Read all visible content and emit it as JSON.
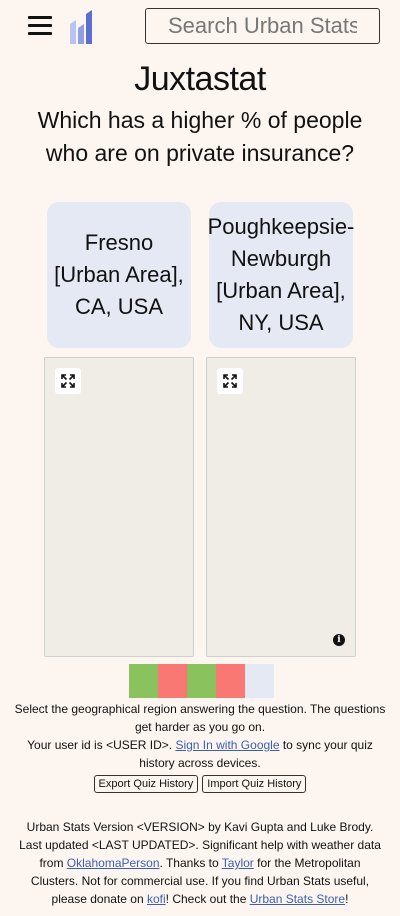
{
  "header": {
    "search_placeholder": "Search Urban Stats",
    "logo_colors": [
      "#5a6fd1",
      "#8f9fe6",
      "#b8c3f2"
    ]
  },
  "title": "Juxtastat",
  "question": "Which has a higher % of people who are on private insurance?",
  "choices": [
    {
      "label": "Fresno [Urban Area], CA, USA"
    },
    {
      "label": "Poughkeepsie-Newburgh [Urban Area], NY, USA"
    }
  ],
  "progress": [
    {
      "result": "correct",
      "color": "#8ac35e"
    },
    {
      "result": "incorrect",
      "color": "#fa7873"
    },
    {
      "result": "correct",
      "color": "#8ac35e"
    },
    {
      "result": "incorrect",
      "color": "#fa7873"
    },
    {
      "result": "pending",
      "color": "#e4e9f3"
    }
  ],
  "instructions": {
    "line1": "Select the geographical region answering the question. The questions get harder as you go on.",
    "user_prefix": "Your user id is ",
    "user_id": "<USER ID>",
    "user_mid": ". ",
    "sign_in": "Sign In with Google",
    "user_suffix": " to sync your quiz history across devices."
  },
  "buttons": {
    "export": "Export Quiz History",
    "import": "Import Quiz History"
  },
  "footer": {
    "p1": "Urban Stats Version <VERSION> by Kavi Gupta and Luke Brody. Last updated <LAST UPDATED>. Significant help with weather data from ",
    "link1": "OklahomaPerson",
    "p2": ". Thanks to ",
    "link2": "Taylor",
    "p3": " for the Metropolitan Clusters. Not for commercial use. If you find Urban Stats useful, please donate on ",
    "link3": "kofi",
    "p4": "! Check out the ",
    "link4": "Urban Stats Store",
    "p5": "!"
  },
  "map_info_symbol": "i"
}
